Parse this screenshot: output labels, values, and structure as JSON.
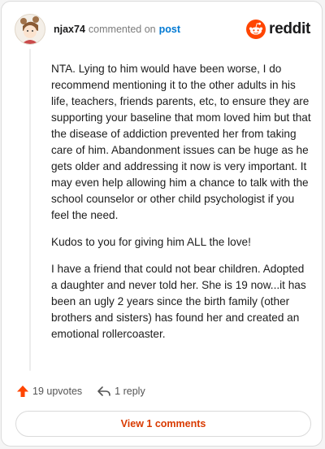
{
  "header": {
    "username": "njax74",
    "commented_text": "commented on",
    "post_link": "post",
    "logo_text": "reddit",
    "brand_color": "#ff4500"
  },
  "comment": {
    "paragraphs": [
      "NTA. Lying to him would have been worse, I do recommend mentioning it to the other adults in his life, teachers, friends parents, etc, to ensure they are supporting your baseline that mom loved him but that the disease of addiction prevented her from taking care of him. Abandonment issues can be huge as he gets older and addressing it now is very important. It may even help allowing him a chance to talk with the school counselor or other child psychologist if you feel the need.",
      "Kudos to you for giving him ALL the love!",
      "I have a friend that could not bear children. Adopted a daughter and never told her. She is 19 now...it has been an ugly 2 years since the birth family (other brothers and sisters) has found her and created an emotional rollercoaster."
    ]
  },
  "actions": {
    "upvotes_label": "19 upvotes",
    "reply_label": "1 reply",
    "upvote_icon": "upvote-arrow-icon",
    "reply_icon": "reply-arrow-icon"
  },
  "footer": {
    "view_comments_label": "View 1 comments"
  }
}
